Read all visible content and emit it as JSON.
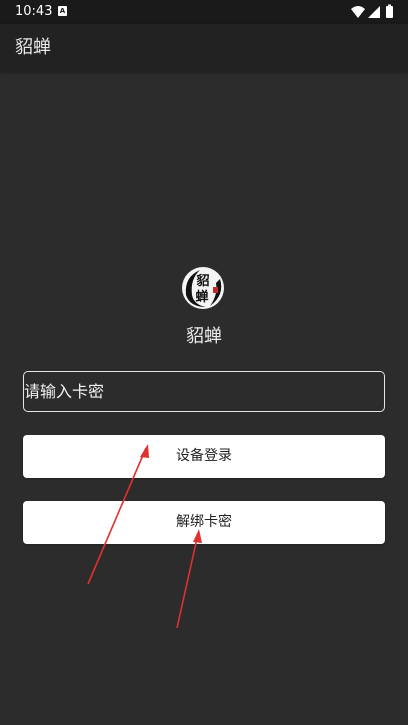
{
  "status_bar": {
    "time": "10:43",
    "app_icon_letter": "A"
  },
  "app_bar": {
    "title": "貂蝉"
  },
  "logo": {
    "label": "貂蝉",
    "glyph_top": "貂",
    "glyph_bottom": "蝉"
  },
  "form": {
    "card_placeholder": "请输入卡密",
    "card_value": ""
  },
  "buttons": {
    "login_label": "设备登录",
    "unbind_label": "解绑卡密"
  },
  "colors": {
    "background": "#2c2c2c",
    "app_bar": "#222222",
    "status_bar": "#1a1a1a",
    "button_bg": "#ffffff",
    "annotation_arrow": "#e03030"
  }
}
